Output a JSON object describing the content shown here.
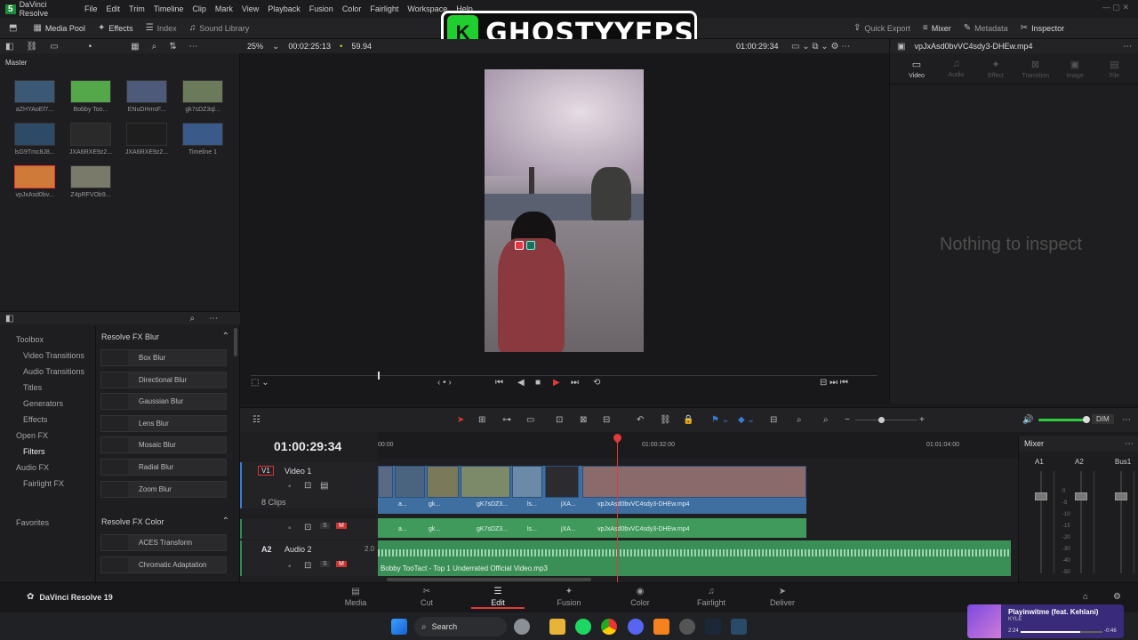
{
  "app": {
    "title": "DaVinci Resolve",
    "badge": "5",
    "version": "DaVinci Resolve 19"
  },
  "menu": [
    "File",
    "Edit",
    "Trim",
    "Timeline",
    "Clip",
    "Mark",
    "View",
    "Playback",
    "Fusion",
    "Color",
    "Fairlight",
    "Workspace",
    "Help"
  ],
  "toolbar": {
    "media_pool": "Media Pool",
    "effects": "Effects",
    "index": "Index",
    "sound_library": "Sound Library",
    "quick_export": "Quick Export",
    "mixer": "Mixer",
    "metadata": "Metadata",
    "inspector": "Inspector"
  },
  "viewer": {
    "zoom": "25%",
    "timecode_in": "00:02:25:13",
    "fps": "59.94",
    "timecode": "01:00:29:34",
    "clip_name": "vpJxAsd0bvVC4sdy3-DHEw.mp4"
  },
  "pool": {
    "folder": "Master",
    "clips": [
      "aZHYAoEf7...",
      "Bobby Too...",
      "ENuDHmsF...",
      "gk7sDZ3ql...",
      "lsG9Tmc8J8...",
      "JXA6RXE9z2...",
      "JXA6RXE9z2...",
      "Timeline 1",
      "vpJxAsd0bv...",
      "Z4pRFVOb9..."
    ]
  },
  "fx": {
    "tree": [
      "Toolbox",
      "Video Transitions",
      "Audio Transitions",
      "Titles",
      "Generators",
      "Effects",
      "Open FX",
      "Filters",
      "Audio FX",
      "Fairlight FX",
      "Favorites"
    ],
    "blur_header": "Resolve FX Blur",
    "blur_items": [
      "Box Blur",
      "Directional Blur",
      "Gaussian Blur",
      "Lens Blur",
      "Mosaic Blur",
      "Radial Blur",
      "Zoom Blur"
    ],
    "color_header": "Resolve FX Color",
    "color_items": [
      "ACES Transform",
      "Chromatic Adaptation"
    ]
  },
  "inspector": {
    "tabs": [
      "Video",
      "Audio",
      "Effect",
      "Transition",
      "Image",
      "File"
    ],
    "empty": "Nothing to inspect"
  },
  "timeline": {
    "timecode": "01:00:29:34",
    "ruler": [
      "00:00",
      "01:00:32:00",
      "01:01:04:00"
    ],
    "v1": {
      "id": "V1",
      "name": "Video 1",
      "clips": "8 Clips"
    },
    "a2": {
      "id": "A2",
      "name": "Audio 2",
      "channels": "2.0"
    },
    "video_clips": [
      "a...",
      "gk...",
      "gK7sDZ3...",
      "ls...",
      "jXA...",
      "vpJxAsd0bvVC4sdy3-DHEw.mp4"
    ],
    "audio_file": "Bobby TooTact - Top 1 Underrated Official Video.mp3",
    "s": "S",
    "m": "M",
    "dim": "DIM"
  },
  "mixer": {
    "title": "Mixer",
    "channels": [
      "A1",
      "A2",
      "Bus1"
    ],
    "scale": [
      "0",
      "-5",
      "-10",
      "-15",
      "-20",
      "-30",
      "-40",
      "-50"
    ]
  },
  "pages": [
    "Media",
    "Cut",
    "Edit",
    "Fusion",
    "Color",
    "Fairlight",
    "Deliver"
  ],
  "taskbar": {
    "search": "Search"
  },
  "media_player": {
    "title": "Playinwitme (feat. Kehlani)",
    "artist": "KYLE",
    "elapsed": "2:24",
    "remaining": "-0:46",
    "progress": 0.73
  },
  "overlay": {
    "logo_text": "GHOSTYYFPS"
  },
  "colors": {
    "accent_red": "#e03a3a",
    "clip_blue": "#4a7bb0",
    "audio_green": "#3f9a5c",
    "active_page": "#e0e0e0"
  }
}
